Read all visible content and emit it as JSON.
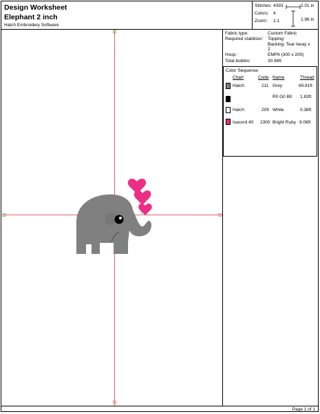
{
  "header": {
    "title": "Design Worksheet",
    "design_name": "Elephant 2 inch",
    "software": "Hatch Embroidery Software"
  },
  "stats": {
    "stitches_label": "Stitches:",
    "stitches_value": "4393",
    "colors_label": "Colors:",
    "colors_value": "4",
    "zoom_label": "Zoom:",
    "zoom_value": "1:1",
    "width": "2.01 in",
    "height": "1.96 in"
  },
  "info": {
    "fabric_type_label": "Fabric type:",
    "fabric_type_value": "Custom Fabric",
    "stabilizer_label": "Required stabilizer:",
    "topping": "Topping:",
    "backing_line1": "Backing: Tear Away x",
    "backing_line2": "2",
    "hoop_label": "Hoop:",
    "hoop_value": "EMP6 (300 x 200)",
    "bobbin_label": "Total bobbin:",
    "bobbin_value": "30.96ft"
  },
  "color_sequence": {
    "title": "Color Sequence:",
    "headers": {
      "chart": "Chart",
      "code": "Code",
      "name": "Name",
      "thread": "Thread"
    },
    "rows": [
      {
        "chart": "Hatch",
        "code": "211",
        "name": "Grey",
        "thread": "69.81ft",
        "color": "#808080"
      },
      {
        "chart": "",
        "code": "",
        "name": "R0 G0 B0",
        "thread": "1.83ft",
        "color": "#000000"
      },
      {
        "chart": "Hatch",
        "code": "209",
        "name": "White",
        "thread": "0.38ft",
        "color": "#ffffff"
      },
      {
        "chart": "Isacord 40",
        "code": "2300",
        "name": "Bright Ruby",
        "thread": "9.06ft",
        "color": "#e8317a"
      }
    ]
  },
  "footer": {
    "page": "Page 1 of 1"
  },
  "colors": {
    "elephant": "#808080",
    "hearts": "#ee2d85",
    "guide": "#e0606a"
  }
}
